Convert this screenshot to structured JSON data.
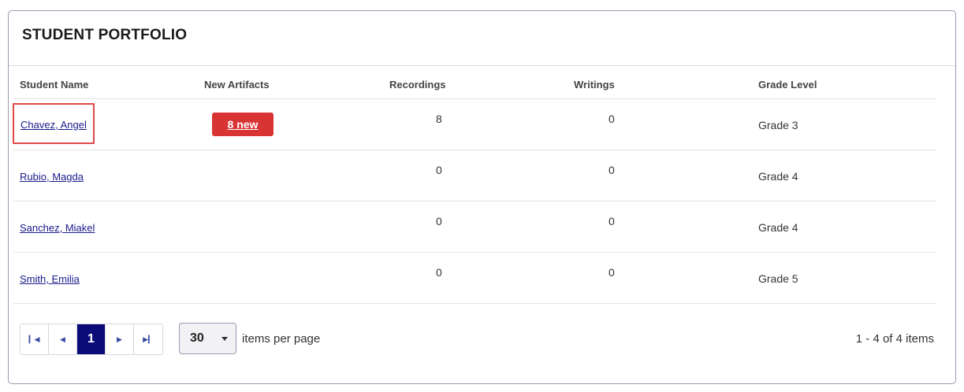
{
  "card": {
    "title": "STUDENT PORTFOLIO"
  },
  "columns": {
    "student_name": "Student Name",
    "new_artifacts": "New Artifacts",
    "recordings": "Recordings",
    "writings": "Writings",
    "grade_level": "Grade Level"
  },
  "rows": [
    {
      "name": "Chavez, Angel",
      "new_artifacts": "8 new",
      "recordings": "8",
      "writings": "0",
      "grade": "Grade 3"
    },
    {
      "name": "Rubio, Magda",
      "new_artifacts": "",
      "recordings": "0",
      "writings": "0",
      "grade": "Grade 4"
    },
    {
      "name": "Sanchez, Miakel",
      "new_artifacts": "",
      "recordings": "0",
      "writings": "0",
      "grade": "Grade 4"
    },
    {
      "name": "Smith, Emilia",
      "new_artifacts": "",
      "recordings": "0",
      "writings": "0",
      "grade": "Grade 5"
    }
  ],
  "pager": {
    "current_page": "1",
    "page_size": "30",
    "items_per_page_label": "items per page",
    "info": "1 - 4 of 4 items"
  },
  "colors": {
    "accent": "#0b0b7a",
    "badge": "#d93434",
    "highlight": "#e04848",
    "link": "#1a1a8c"
  },
  "icons": [
    "first-page-icon",
    "previous-page-icon",
    "next-page-icon",
    "last-page-icon",
    "dropdown-caret-icon"
  ]
}
